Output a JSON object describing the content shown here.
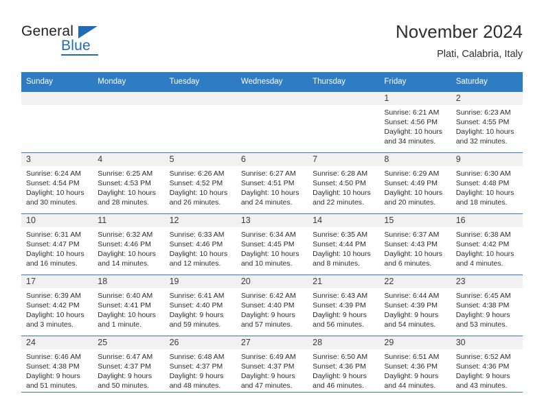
{
  "brand": {
    "name_part1": "General",
    "name_part2": "Blue",
    "triangle_icon": "blue-triangle-icon",
    "accent_color": "#1f6cb4"
  },
  "header": {
    "title": "November 2024",
    "subtitle": "Plati, Calabria, Italy"
  },
  "theme": {
    "header_bg": "#2e7cc3",
    "daynum_bg": "#f1f1f1",
    "grid_line": "#2e7cc3",
    "text": "#2b2b2b"
  },
  "weekday_headers": [
    "Sunday",
    "Monday",
    "Tuesday",
    "Wednesday",
    "Thursday",
    "Friday",
    "Saturday"
  ],
  "weeks": [
    [
      {
        "day": "",
        "empty": true
      },
      {
        "day": "",
        "empty": true
      },
      {
        "day": "",
        "empty": true
      },
      {
        "day": "",
        "empty": true
      },
      {
        "day": "",
        "empty": true
      },
      {
        "day": "1",
        "sunrise": "Sunrise: 6:21 AM",
        "sunset": "Sunset: 4:56 PM",
        "daylight_line1": "Daylight: 10 hours",
        "daylight_line2": "and 34 minutes."
      },
      {
        "day": "2",
        "sunrise": "Sunrise: 6:23 AM",
        "sunset": "Sunset: 4:55 PM",
        "daylight_line1": "Daylight: 10 hours",
        "daylight_line2": "and 32 minutes."
      }
    ],
    [
      {
        "day": "3",
        "sunrise": "Sunrise: 6:24 AM",
        "sunset": "Sunset: 4:54 PM",
        "daylight_line1": "Daylight: 10 hours",
        "daylight_line2": "and 30 minutes."
      },
      {
        "day": "4",
        "sunrise": "Sunrise: 6:25 AM",
        "sunset": "Sunset: 4:53 PM",
        "daylight_line1": "Daylight: 10 hours",
        "daylight_line2": "and 28 minutes."
      },
      {
        "day": "5",
        "sunrise": "Sunrise: 6:26 AM",
        "sunset": "Sunset: 4:52 PM",
        "daylight_line1": "Daylight: 10 hours",
        "daylight_line2": "and 26 minutes."
      },
      {
        "day": "6",
        "sunrise": "Sunrise: 6:27 AM",
        "sunset": "Sunset: 4:51 PM",
        "daylight_line1": "Daylight: 10 hours",
        "daylight_line2": "and 24 minutes."
      },
      {
        "day": "7",
        "sunrise": "Sunrise: 6:28 AM",
        "sunset": "Sunset: 4:50 PM",
        "daylight_line1": "Daylight: 10 hours",
        "daylight_line2": "and 22 minutes."
      },
      {
        "day": "8",
        "sunrise": "Sunrise: 6:29 AM",
        "sunset": "Sunset: 4:49 PM",
        "daylight_line1": "Daylight: 10 hours",
        "daylight_line2": "and 20 minutes."
      },
      {
        "day": "9",
        "sunrise": "Sunrise: 6:30 AM",
        "sunset": "Sunset: 4:48 PM",
        "daylight_line1": "Daylight: 10 hours",
        "daylight_line2": "and 18 minutes."
      }
    ],
    [
      {
        "day": "10",
        "sunrise": "Sunrise: 6:31 AM",
        "sunset": "Sunset: 4:47 PM",
        "daylight_line1": "Daylight: 10 hours",
        "daylight_line2": "and 16 minutes."
      },
      {
        "day": "11",
        "sunrise": "Sunrise: 6:32 AM",
        "sunset": "Sunset: 4:46 PM",
        "daylight_line1": "Daylight: 10 hours",
        "daylight_line2": "and 14 minutes."
      },
      {
        "day": "12",
        "sunrise": "Sunrise: 6:33 AM",
        "sunset": "Sunset: 4:46 PM",
        "daylight_line1": "Daylight: 10 hours",
        "daylight_line2": "and 12 minutes."
      },
      {
        "day": "13",
        "sunrise": "Sunrise: 6:34 AM",
        "sunset": "Sunset: 4:45 PM",
        "daylight_line1": "Daylight: 10 hours",
        "daylight_line2": "and 10 minutes."
      },
      {
        "day": "14",
        "sunrise": "Sunrise: 6:35 AM",
        "sunset": "Sunset: 4:44 PM",
        "daylight_line1": "Daylight: 10 hours",
        "daylight_line2": "and 8 minutes."
      },
      {
        "day": "15",
        "sunrise": "Sunrise: 6:37 AM",
        "sunset": "Sunset: 4:43 PM",
        "daylight_line1": "Daylight: 10 hours",
        "daylight_line2": "and 6 minutes."
      },
      {
        "day": "16",
        "sunrise": "Sunrise: 6:38 AM",
        "sunset": "Sunset: 4:42 PM",
        "daylight_line1": "Daylight: 10 hours",
        "daylight_line2": "and 4 minutes."
      }
    ],
    [
      {
        "day": "17",
        "sunrise": "Sunrise: 6:39 AM",
        "sunset": "Sunset: 4:42 PM",
        "daylight_line1": "Daylight: 10 hours",
        "daylight_line2": "and 3 minutes."
      },
      {
        "day": "18",
        "sunrise": "Sunrise: 6:40 AM",
        "sunset": "Sunset: 4:41 PM",
        "daylight_line1": "Daylight: 10 hours",
        "daylight_line2": "and 1 minute."
      },
      {
        "day": "19",
        "sunrise": "Sunrise: 6:41 AM",
        "sunset": "Sunset: 4:40 PM",
        "daylight_line1": "Daylight: 9 hours",
        "daylight_line2": "and 59 minutes."
      },
      {
        "day": "20",
        "sunrise": "Sunrise: 6:42 AM",
        "sunset": "Sunset: 4:40 PM",
        "daylight_line1": "Daylight: 9 hours",
        "daylight_line2": "and 57 minutes."
      },
      {
        "day": "21",
        "sunrise": "Sunrise: 6:43 AM",
        "sunset": "Sunset: 4:39 PM",
        "daylight_line1": "Daylight: 9 hours",
        "daylight_line2": "and 56 minutes."
      },
      {
        "day": "22",
        "sunrise": "Sunrise: 6:44 AM",
        "sunset": "Sunset: 4:39 PM",
        "daylight_line1": "Daylight: 9 hours",
        "daylight_line2": "and 54 minutes."
      },
      {
        "day": "23",
        "sunrise": "Sunrise: 6:45 AM",
        "sunset": "Sunset: 4:38 PM",
        "daylight_line1": "Daylight: 9 hours",
        "daylight_line2": "and 53 minutes."
      }
    ],
    [
      {
        "day": "24",
        "sunrise": "Sunrise: 6:46 AM",
        "sunset": "Sunset: 4:38 PM",
        "daylight_line1": "Daylight: 9 hours",
        "daylight_line2": "and 51 minutes."
      },
      {
        "day": "25",
        "sunrise": "Sunrise: 6:47 AM",
        "sunset": "Sunset: 4:37 PM",
        "daylight_line1": "Daylight: 9 hours",
        "daylight_line2": "and 50 minutes."
      },
      {
        "day": "26",
        "sunrise": "Sunrise: 6:48 AM",
        "sunset": "Sunset: 4:37 PM",
        "daylight_line1": "Daylight: 9 hours",
        "daylight_line2": "and 48 minutes."
      },
      {
        "day": "27",
        "sunrise": "Sunrise: 6:49 AM",
        "sunset": "Sunset: 4:37 PM",
        "daylight_line1": "Daylight: 9 hours",
        "daylight_line2": "and 47 minutes."
      },
      {
        "day": "28",
        "sunrise": "Sunrise: 6:50 AM",
        "sunset": "Sunset: 4:36 PM",
        "daylight_line1": "Daylight: 9 hours",
        "daylight_line2": "and 46 minutes."
      },
      {
        "day": "29",
        "sunrise": "Sunrise: 6:51 AM",
        "sunset": "Sunset: 4:36 PM",
        "daylight_line1": "Daylight: 9 hours",
        "daylight_line2": "and 44 minutes."
      },
      {
        "day": "30",
        "sunrise": "Sunrise: 6:52 AM",
        "sunset": "Sunset: 4:36 PM",
        "daylight_line1": "Daylight: 9 hours",
        "daylight_line2": "and 43 minutes."
      }
    ]
  ]
}
